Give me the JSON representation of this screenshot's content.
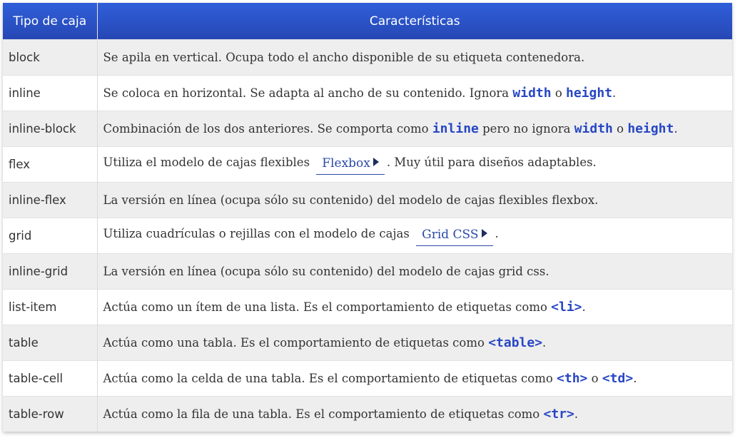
{
  "headers": {
    "col1": "Tipo de caja",
    "col2": "Características"
  },
  "rows": [
    {
      "type": "block",
      "t1": "Se apila en vertical. Ocupa todo el ancho disponible de su etiqueta contenedora."
    },
    {
      "type": "inline",
      "t1": "Se coloca en horizontal. Se adapta al ancho de su contenido. Ignora ",
      "k1": "width",
      "t2": " o ",
      "k2": "height",
      "t3": "."
    },
    {
      "type": "inline-block",
      "t1": "Combinación de los dos anteriores. Se comporta como ",
      "k1": "inline",
      "t2": " pero no ignora ",
      "k2": "width",
      "t3": " o ",
      "k3": "height",
      "t4": "."
    },
    {
      "type": "flex",
      "t1": "Utiliza el modelo de cajas flexibles ",
      "link": "Flexbox",
      "t2": ". Muy útil para diseños adaptables."
    },
    {
      "type": "inline-flex",
      "t1": "La versión en línea (ocupa sólo su contenido) del modelo de cajas flexibles flexbox."
    },
    {
      "type": "grid",
      "t1": "Utiliza cuadrículas o rejillas con el modelo de cajas ",
      "link": "Grid CSS",
      "t2": "."
    },
    {
      "type": "inline-grid",
      "t1": "La versión en línea (ocupa sólo su contenido) del modelo de cajas grid css."
    },
    {
      "type": "list-item",
      "t1": "Actúa como un ítem de una lista. Es el comportamiento de etiquetas como ",
      "k1": "<li>",
      "t2": "."
    },
    {
      "type": "table",
      "t1": "Actúa como una tabla. Es el comportamiento de etiquetas como ",
      "k1": "<table>",
      "t2": "."
    },
    {
      "type": "table-cell",
      "t1": "Actúa como la celda de una tabla. Es el comportamiento de etiquetas como ",
      "k1": "<th>",
      "t2": " o ",
      "k2": "<td>",
      "t3": "."
    },
    {
      "type": "table-row",
      "t1": "Actúa como la fila de una tabla. Es el comportamiento de etiquetas como ",
      "k1": "<tr>",
      "t2": "."
    }
  ],
  "colors": {
    "header_bg": "#2a52c6",
    "keyword": "#2847c4",
    "link": "#2a49a8",
    "row_alt": "#eeeeee"
  }
}
